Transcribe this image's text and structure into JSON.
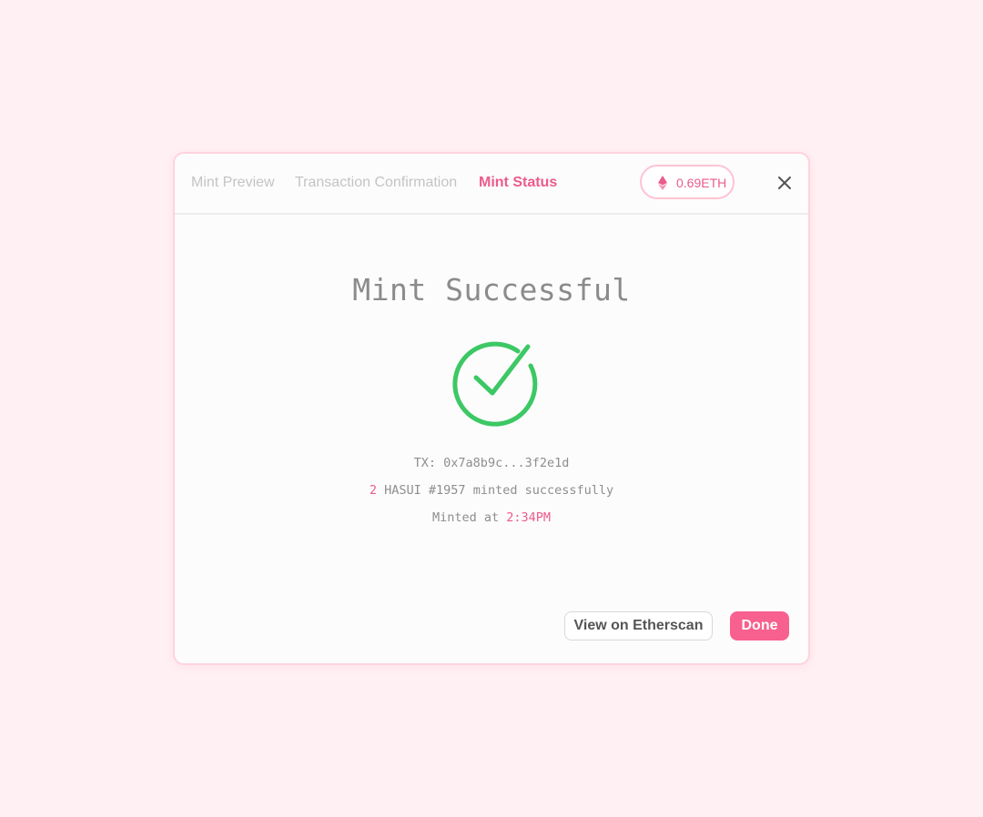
{
  "tabs": [
    {
      "label": "Mint Preview",
      "active": false
    },
    {
      "label": "Transaction Confirmation",
      "active": false
    },
    {
      "label": "Mint Status",
      "active": true
    }
  ],
  "balance": {
    "icon": "ethereum-icon",
    "amount": "0.69ETH"
  },
  "close": {
    "icon": "close-icon"
  },
  "status": {
    "title": "Mint Successful",
    "icon": "check-circle-icon",
    "tx_label": "TX:",
    "tx_hash": "0x7a8b9c...3f2e1d",
    "quantity": "2",
    "minted_text": "HASUI #1957 minted successfully",
    "minted_at_label": "Minted at",
    "minted_time": "2:34PM"
  },
  "actions": {
    "etherscan_label": "View on Etherscan",
    "done_label": "Done"
  },
  "colors": {
    "accent": "#ec5b8c",
    "primary_button": "#f8608f",
    "success": "#3cc864",
    "background": "#fff0f4"
  }
}
